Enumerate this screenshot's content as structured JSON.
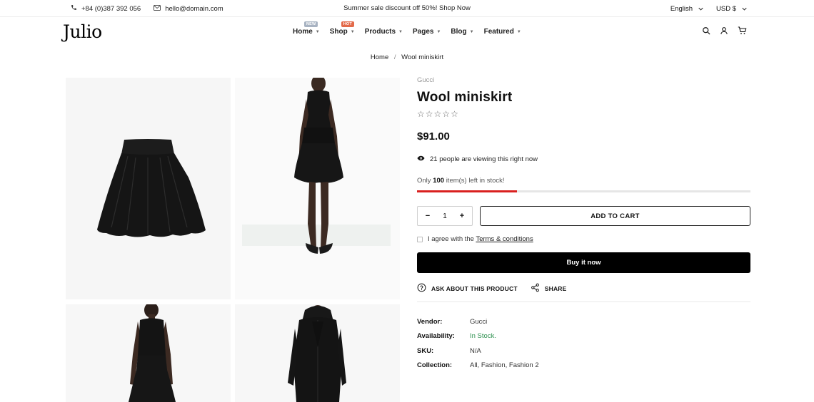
{
  "topbar": {
    "phone": "+84 (0)387 392 056",
    "email": "hello@domain.com",
    "promo": "Summer sale discount off 50%! Shop Now",
    "language": "English",
    "currency": "USD $"
  },
  "header": {
    "logo": "Julio",
    "nav": [
      {
        "label": "Home",
        "badge": "NEW"
      },
      {
        "label": "Shop",
        "badge": "HOT"
      },
      {
        "label": "Products",
        "badge": ""
      },
      {
        "label": "Pages",
        "badge": ""
      },
      {
        "label": "Blog",
        "badge": ""
      },
      {
        "label": "Featured",
        "badge": ""
      }
    ]
  },
  "breadcrumb": {
    "home": "Home",
    "separator": "/",
    "current": "Wool miniskirt"
  },
  "product": {
    "vendor": "Gucci",
    "title": "Wool miniskirt",
    "rating": 0,
    "rating_max": 5,
    "price": "$91.00",
    "viewing_count": "21",
    "viewing_text": "people are viewing this right now",
    "stock_prefix": "Only",
    "stock_count": "100",
    "stock_suffix": "item(s) left in stock!",
    "stock_bar_fraction": 0.3,
    "quantity": "1",
    "add_to_cart": "ADD TO CART",
    "agree_prefix": "I agree with the",
    "agree_link": "Terms & conditions",
    "buy_now": "Buy it now",
    "ask": "ASK ABOUT THIS PRODUCT",
    "share": "SHARE",
    "meta": [
      {
        "key": "Vendor:",
        "value": "Gucci"
      },
      {
        "key": "Availability:",
        "value": "In Stock."
      },
      {
        "key": "SKU:",
        "value": "N/A"
      },
      {
        "key": "Collection:",
        "value": "All, Fashion, Fashion 2"
      }
    ]
  },
  "colors": {
    "accent_red": "#d9201f",
    "in_stock_green": "#2e9150",
    "badge_new": "#a8b3c2",
    "badge_hot": "#e36a4a"
  },
  "icons": [
    "phone-icon",
    "mail-icon",
    "search-icon",
    "user-icon",
    "cart-icon",
    "eye-icon",
    "question-icon",
    "share-icon"
  ]
}
